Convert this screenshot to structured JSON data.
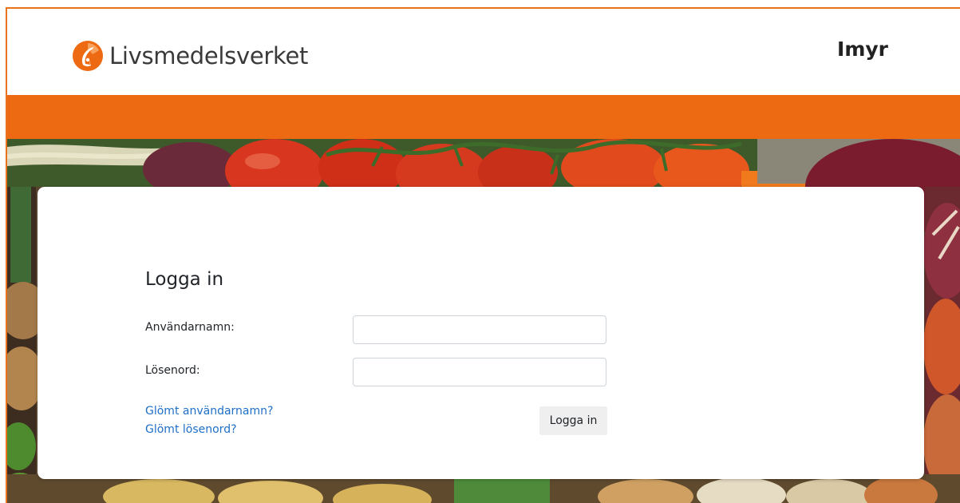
{
  "header": {
    "brand_name": "Livsmedelsverket",
    "app_name": "Imyr"
  },
  "colors": {
    "brand_orange": "#ee6a12",
    "link_blue": "#1f6fc7",
    "frame_border": "#e8731c"
  },
  "login": {
    "title": "Logga in",
    "username_label": "Användarnamn:",
    "username_value": "",
    "password_label": "Lösenord:",
    "password_value": "",
    "forgot_username_link": "Glömt användarnamn?",
    "forgot_password_link": "Glömt lösenord?",
    "submit_label": "Logga in"
  },
  "icons": {
    "brand_logo": "livsmedelsverket-logo-icon"
  }
}
